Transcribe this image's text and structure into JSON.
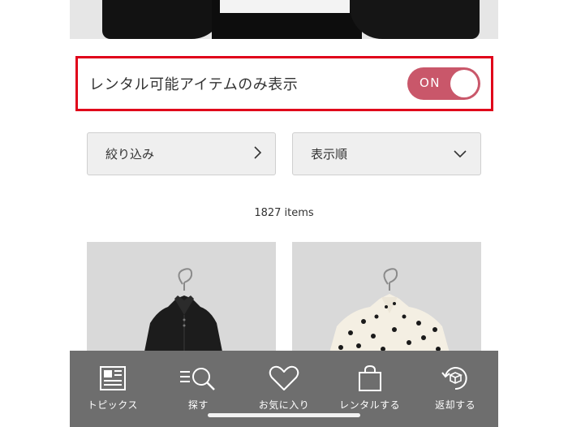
{
  "toggle": {
    "label": "レンタル可能アイテムのみ表示",
    "state_text": "ON",
    "is_on": true,
    "color": "#c9576a",
    "highlight_border": "#e0001a"
  },
  "filters": {
    "narrow_label": "絞り込み",
    "sort_label": "表示順"
  },
  "results": {
    "count_text": "1827 items"
  },
  "tabbar": {
    "items": [
      {
        "label": "トピックス",
        "icon": "newspaper-icon"
      },
      {
        "label": "探す",
        "icon": "search-list-icon"
      },
      {
        "label": "お気に入り",
        "icon": "heart-icon"
      },
      {
        "label": "レンタルする",
        "icon": "shopping-bag-icon"
      },
      {
        "label": "返却する",
        "icon": "return-box-icon"
      }
    ]
  }
}
